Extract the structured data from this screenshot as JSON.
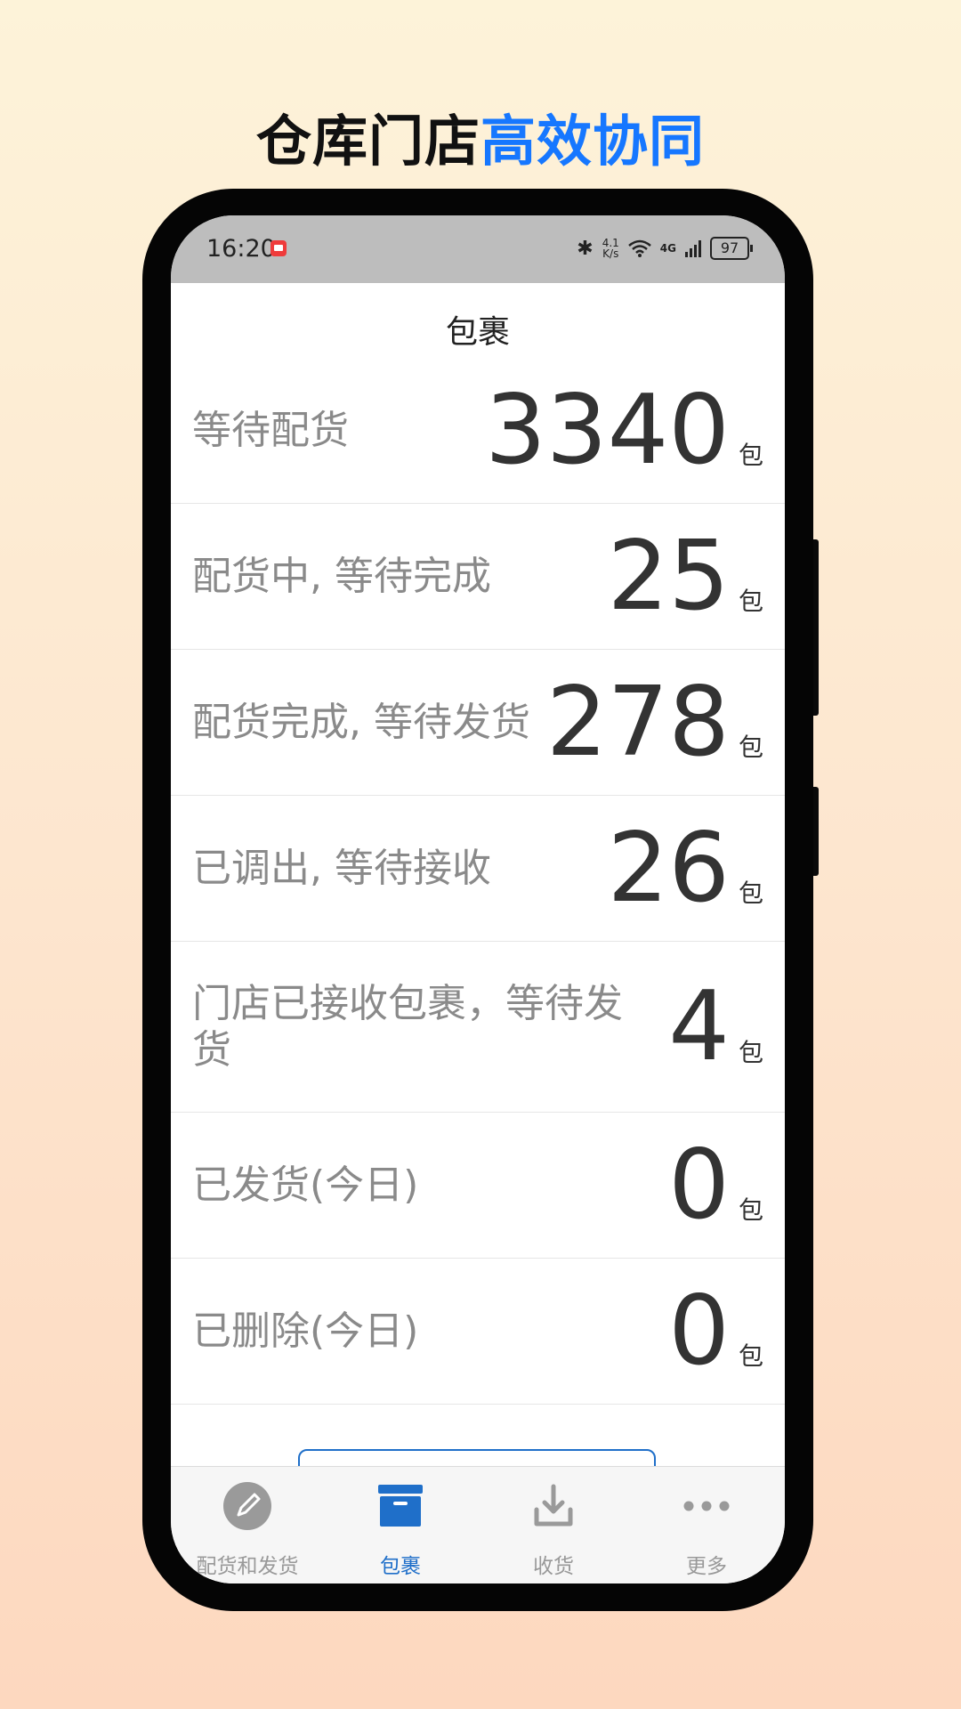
{
  "headline": {
    "part1": "仓库门店",
    "part2": "高效协同"
  },
  "status_bar": {
    "time": "16:20",
    "speed_top": "4.1",
    "speed_bottom": "K/s",
    "network": "4G",
    "battery": "97"
  },
  "page": {
    "title": "包裹"
  },
  "rows": [
    {
      "label": "等待配货",
      "value": "3340",
      "unit": "包"
    },
    {
      "label": "配货中, 等待完成",
      "value": "25",
      "unit": "包"
    },
    {
      "label": "配货完成, 等待发货",
      "value": "278",
      "unit": "包"
    },
    {
      "label": "已调出, 等待接收",
      "value": "26",
      "unit": "包"
    },
    {
      "label": "门店已接收包裹，等待发货",
      "value": "4",
      "unit": "包"
    },
    {
      "label": "已发货(今日)",
      "value": "0",
      "unit": "包"
    },
    {
      "label": "已删除(今日)",
      "value": "0",
      "unit": "包"
    }
  ],
  "tabs": [
    {
      "label": "配货和发货",
      "icon": "pencil-circle-icon"
    },
    {
      "label": "包裹",
      "icon": "package-box-icon"
    },
    {
      "label": "收货",
      "icon": "receive-download-icon"
    },
    {
      "label": "更多",
      "icon": "more-dots-icon"
    }
  ],
  "colors": {
    "accent": "#1f6fc9",
    "headline_blue": "#1677ff",
    "label_gray": "#8a8a8a",
    "value_dark": "#333333"
  }
}
